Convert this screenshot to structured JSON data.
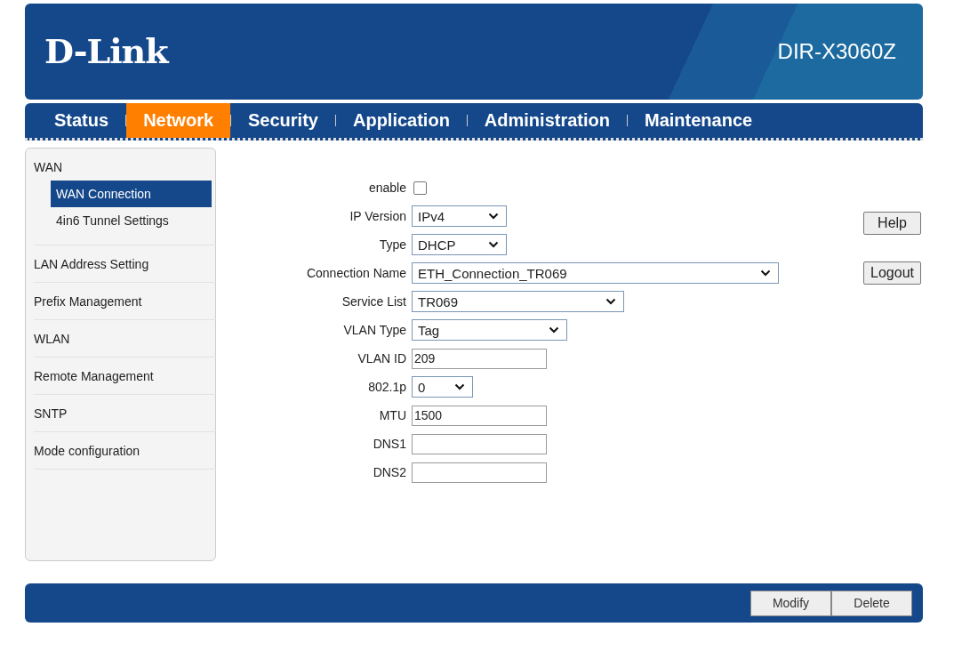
{
  "header": {
    "logo": "D-Link",
    "model": "DIR-X3060Z"
  },
  "nav": [
    {
      "label": "Status",
      "selected": false
    },
    {
      "label": "Network",
      "selected": true
    },
    {
      "label": "Security",
      "selected": false
    },
    {
      "label": "Application",
      "selected": false
    },
    {
      "label": "Administration",
      "selected": false
    },
    {
      "label": "Maintenance",
      "selected": false
    }
  ],
  "sidebar": {
    "items": [
      {
        "label": "WAN",
        "children": [
          {
            "label": "WAN Connection",
            "selected": true
          },
          {
            "label": "4in6 Tunnel Settings",
            "selected": false
          }
        ]
      },
      {
        "label": "LAN Address Setting",
        "selected": false
      },
      {
        "label": "Prefix Management",
        "selected": false
      },
      {
        "label": "WLAN",
        "selected": false
      },
      {
        "label": "Remote Management",
        "selected": false
      },
      {
        "label": "SNTP",
        "selected": false
      },
      {
        "label": "Mode configuration",
        "selected": false
      }
    ]
  },
  "form": [
    {
      "kind": "checkbox",
      "label": "enable",
      "checked": false
    },
    {
      "kind": "select",
      "label": "IP Version",
      "value": "IPv4"
    },
    {
      "kind": "select",
      "label": "Type",
      "value": "DHCP"
    },
    {
      "kind": "select",
      "label": "Connection Name",
      "value": "ETH_Connection_TR069"
    },
    {
      "kind": "select",
      "label": "Service List",
      "value": "TR069"
    },
    {
      "kind": "select",
      "label": "VLAN Type",
      "value": "Tag"
    },
    {
      "kind": "input",
      "label": "VLAN ID",
      "value": "209"
    },
    {
      "kind": "select",
      "label": "802.1p",
      "value": "0"
    },
    {
      "kind": "input",
      "label": "MTU",
      "value": "1500"
    },
    {
      "kind": "input",
      "label": "DNS1"
    },
    {
      "kind": "input",
      "label": "DNS2"
    }
  ],
  "side_buttons": [
    "Help",
    "Logout"
  ],
  "footer_buttons": [
    "Modify",
    "Delete"
  ]
}
